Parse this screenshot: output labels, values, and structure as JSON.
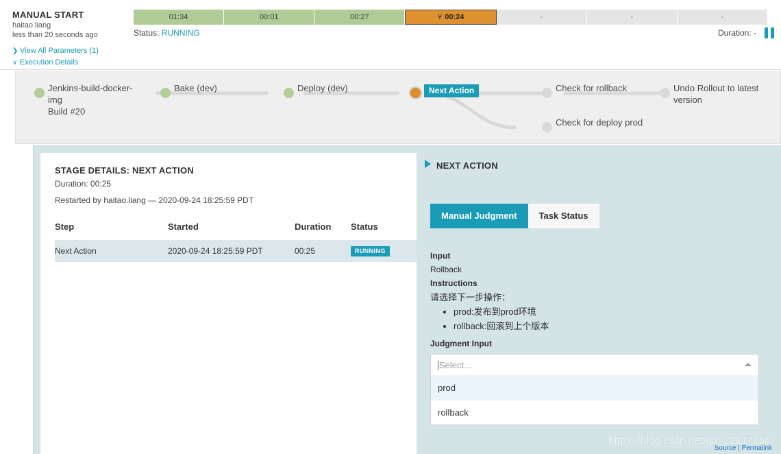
{
  "header": {
    "title": "MANUAL START",
    "user": "haitao.liang",
    "relative_time": "less than 20 seconds ago",
    "view_all_parameters": "View All Parameters (1)",
    "execution_details": "Execution Details",
    "status_label": "Status:",
    "status_value": "RUNNING",
    "duration_label": "Duration: -",
    "chevron_right": "❯",
    "chevron_down": "∨",
    "pause_icon": "pause-icon"
  },
  "timeline": {
    "segments": [
      {
        "label": "01:34",
        "state": "green"
      },
      {
        "label": "00:01",
        "state": "green"
      },
      {
        "label": "00:27",
        "state": "green"
      },
      {
        "label": "00:24",
        "state": "orange",
        "icon": "person-icon"
      },
      {
        "label": "-",
        "state": "empty"
      },
      {
        "label": "-",
        "state": "empty"
      },
      {
        "label": "-",
        "state": "empty"
      }
    ]
  },
  "pipeline": {
    "stages": [
      {
        "label": "Jenkins-build-docker-img",
        "sub": "Build #20",
        "state": "done",
        "badge": null
      },
      {
        "label": "Bake (dev)",
        "sub": "",
        "state": "done",
        "badge": null
      },
      {
        "label": "Deploy (dev)",
        "sub": "",
        "state": "done",
        "badge": null
      },
      {
        "label": "",
        "sub": "",
        "state": "active",
        "badge": "Next Action"
      },
      {
        "label": "Check for rollback",
        "sub": "",
        "state": "pending",
        "badge": null
      },
      {
        "label": "Undo Rollout to latest version",
        "sub": "",
        "state": "pending",
        "badge": null
      },
      {
        "label": "Check for deploy prod",
        "sub": "",
        "state": "pending",
        "badge": null
      }
    ]
  },
  "stage_details": {
    "title": "STAGE DETAILS: NEXT ACTION",
    "duration": "Duration: 00:25",
    "restarted": "Restarted by haitao.liang — 2020-09-24 18:25:59 PDT",
    "columns": [
      "Step",
      "Started",
      "Duration",
      "Status"
    ],
    "rows": [
      {
        "step": "Next Action",
        "started": "2020-09-24 18:25:59 PDT",
        "duration": "00:25",
        "status": "RUNNING"
      }
    ]
  },
  "next_action": {
    "heading": "NEXT ACTION",
    "tabs": [
      {
        "label": "Manual Judgment",
        "active": true
      },
      {
        "label": "Task Status",
        "active": false
      }
    ],
    "input_label": "Input",
    "input_value": "Rollback",
    "instructions_label": "Instructions",
    "instructions_text": "请选择下一步操作：",
    "instructions_items": [
      "prod:发布到prod环境",
      "rollback:回滚到上个版本"
    ],
    "judgment_input_label": "Judgment Input",
    "select_placeholder": "Select...",
    "select_value": "",
    "options": [
      {
        "label": "prod",
        "highlighted": true
      },
      {
        "label": "rollback",
        "highlighted": false
      }
    ]
  },
  "footer": {
    "source_permalink": "Source | Permalink",
    "watermark": "https://blog.csdn.net/qq_22917166"
  },
  "colors": {
    "accent_teal": "#1a9cb7",
    "running_green": "#b0cb96",
    "active_orange": "#e0912f",
    "panel_blue": "#d3e3e6",
    "row_blue": "#dbe7ea"
  }
}
